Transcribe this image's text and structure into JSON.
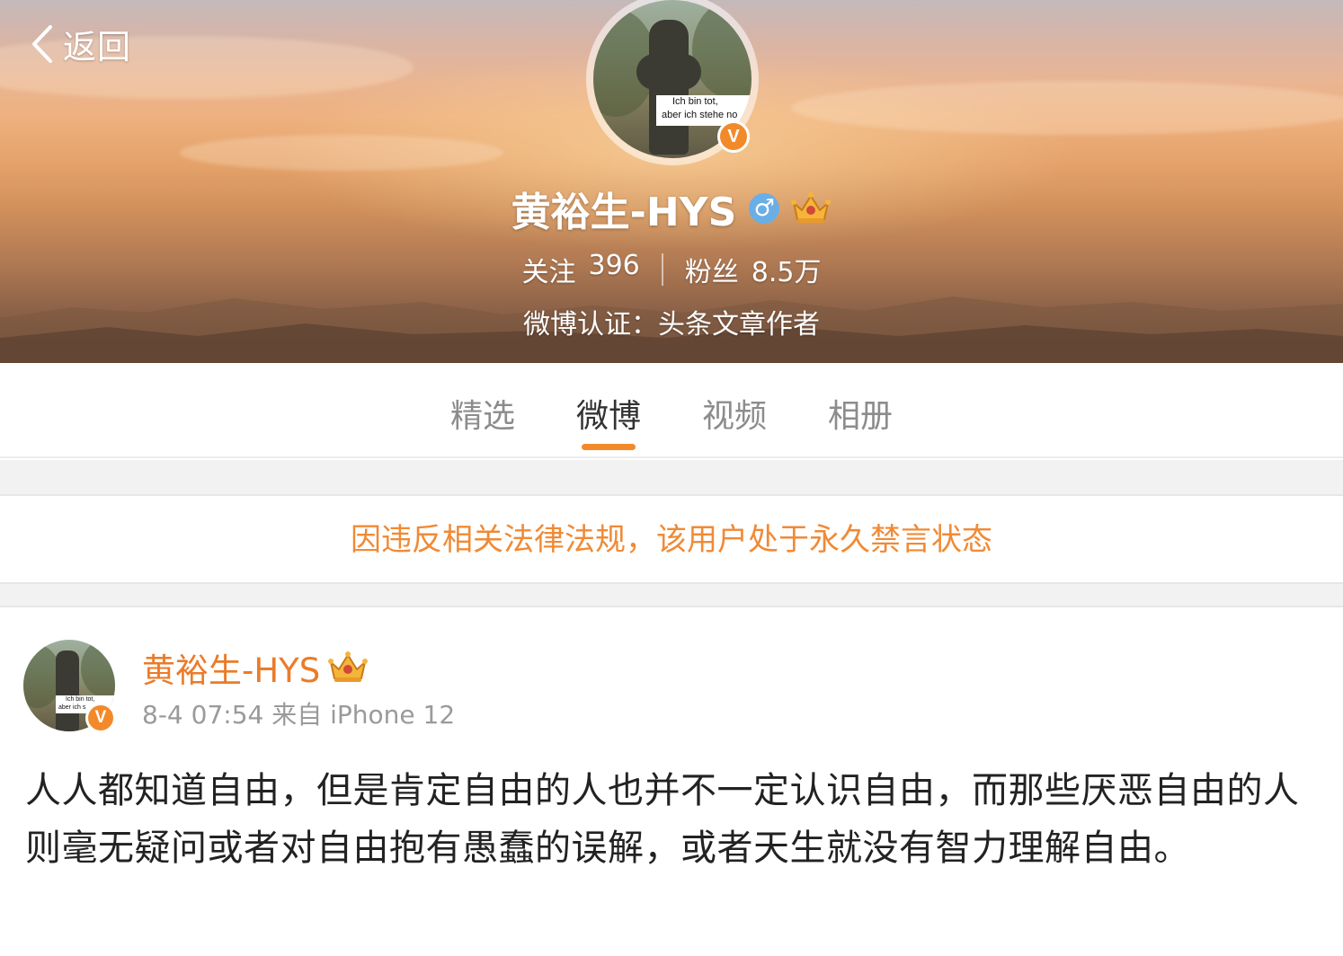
{
  "header": {
    "back_label": "返回",
    "avatar_caption_line1": "Ich bin tot,",
    "avatar_caption_line2": "aber ich stehe no",
    "verified_badge": "V",
    "name": "黄裕生-HYS",
    "gender_icon": "male-icon",
    "gender_symbol": "♂",
    "member_icon": "crown-icon",
    "following_label": "关注",
    "following_count": "396",
    "followers_label": "粉丝",
    "followers_count": "8.5万",
    "verification": "微博认证：头条文章作者"
  },
  "tabs": [
    {
      "label": "精选",
      "active": false
    },
    {
      "label": "微博",
      "active": true
    },
    {
      "label": "视频",
      "active": false
    },
    {
      "label": "相册",
      "active": false
    }
  ],
  "notice": "因违反相关法律法规，该用户处于永久禁言状态",
  "post": {
    "author": "黄裕生-HYS",
    "avatar_caption_line1": "Ich bin tot,",
    "avatar_caption_line2": "aber ich s",
    "verified_badge": "V",
    "meta": "8-4 07:54 来自 iPhone 12",
    "text": "人人都知道自由，但是肯定自由的人也并不一定认识自由，而那些厌恶自由的人则毫无疑问或者对自由抱有愚蠢的误解，或者天生就没有智力理解自由。"
  },
  "colors": {
    "accent_orange": "#f28a2a",
    "notice_text": "#f08a35",
    "author_name": "#eb7b29",
    "gender_blue": "#6aaee6"
  }
}
